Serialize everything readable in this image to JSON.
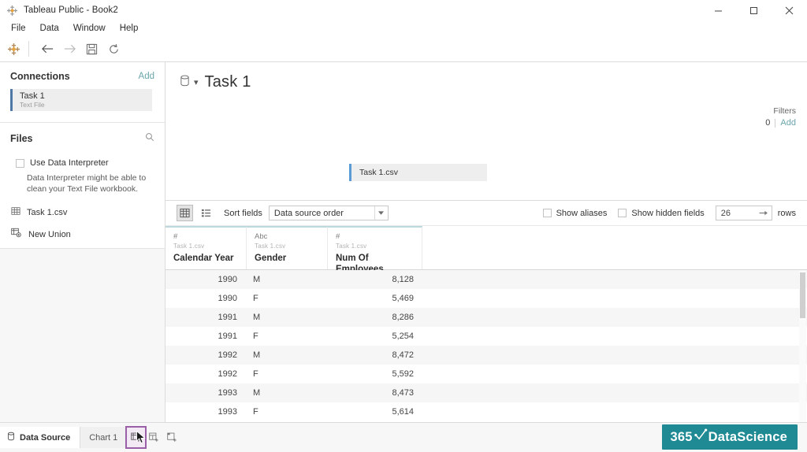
{
  "window": {
    "title": "Tableau Public - Book2",
    "logo_icon": "tableau-logo-icon",
    "controls": [
      {
        "name": "minimize",
        "icon": "minimize-icon"
      },
      {
        "name": "maximize",
        "icon": "maximize-icon"
      },
      {
        "name": "close",
        "icon": "close-icon"
      }
    ]
  },
  "menubar": {
    "items": [
      {
        "label": "File"
      },
      {
        "label": "Data"
      },
      {
        "label": "Window"
      },
      {
        "label": "Help"
      }
    ]
  },
  "toolbar": {
    "logo_icon": "tableau-logo-icon",
    "buttons": [
      {
        "name": "back-button",
        "icon": "arrow-left-icon"
      },
      {
        "name": "forward-button",
        "icon": "arrow-right-icon"
      },
      {
        "name": "save-button",
        "icon": "save-icon"
      },
      {
        "name": "refresh-button",
        "icon": "refresh-icon"
      }
    ]
  },
  "sidebar": {
    "connections": {
      "title": "Connections",
      "add_label": "Add",
      "items": [
        {
          "name": "Task 1",
          "type": "Text File"
        }
      ]
    },
    "files": {
      "title": "Files",
      "search_icon": "search-icon",
      "interpreter": {
        "label": "Use Data Interpreter",
        "checked": false,
        "hint": "Data Interpreter might be able to clean your Text File workbook."
      },
      "items": [
        {
          "label": "Task 1.csv",
          "icon": "table-icon"
        }
      ],
      "new_union_label": "New Union",
      "new_union_icon": "union-icon"
    }
  },
  "canvas": {
    "source_icon": "database-icon",
    "title": "Task 1",
    "filters": {
      "label": "Filters",
      "count": "0",
      "add_label": "Add"
    },
    "table_card": {
      "label": "Task 1.csv"
    }
  },
  "gridbar": {
    "grid_view_icon": "grid-view-icon",
    "list_view_icon": "list-view-icon",
    "sort_label": "Sort fields",
    "sort_value": "Data source order",
    "show_aliases": {
      "label": "Show aliases",
      "checked": false
    },
    "show_hidden_fields": {
      "label": "Show hidden fields",
      "checked": false
    },
    "rows_value": "26",
    "rows_label": "rows"
  },
  "grid": {
    "source_label": "Task 1.csv",
    "columns": [
      {
        "type": "#",
        "name": "Calendar Year",
        "align": "right"
      },
      {
        "type": "Abc",
        "name": "Gender",
        "align": "left"
      },
      {
        "type": "#",
        "name": "Num Of Employees",
        "align": "right"
      }
    ],
    "rows": [
      {
        "c1": "1990",
        "c2": "M",
        "c3": "8,128"
      },
      {
        "c1": "1990",
        "c2": "F",
        "c3": "5,469"
      },
      {
        "c1": "1991",
        "c2": "M",
        "c3": "8,286"
      },
      {
        "c1": "1991",
        "c2": "F",
        "c3": "5,254"
      },
      {
        "c1": "1992",
        "c2": "M",
        "c3": "8,472"
      },
      {
        "c1": "1992",
        "c2": "F",
        "c3": "5,592"
      },
      {
        "c1": "1993",
        "c2": "M",
        "c3": "8,473"
      },
      {
        "c1": "1993",
        "c2": "F",
        "c3": "5,614"
      }
    ]
  },
  "statusbar": {
    "data_source_tab": "Data Source",
    "sheet_tab": "Chart 1",
    "buttons": [
      {
        "name": "new-worksheet-button",
        "icon": "new-worksheet-icon",
        "highlighted": true
      },
      {
        "name": "new-dashboard-button",
        "icon": "new-dashboard-icon",
        "highlighted": false
      },
      {
        "name": "new-story-button",
        "icon": "new-story-icon",
        "highlighted": false
      }
    ]
  },
  "watermark": {
    "prefix": "365",
    "suffix": "DataScience",
    "color": "#1f8a93"
  }
}
